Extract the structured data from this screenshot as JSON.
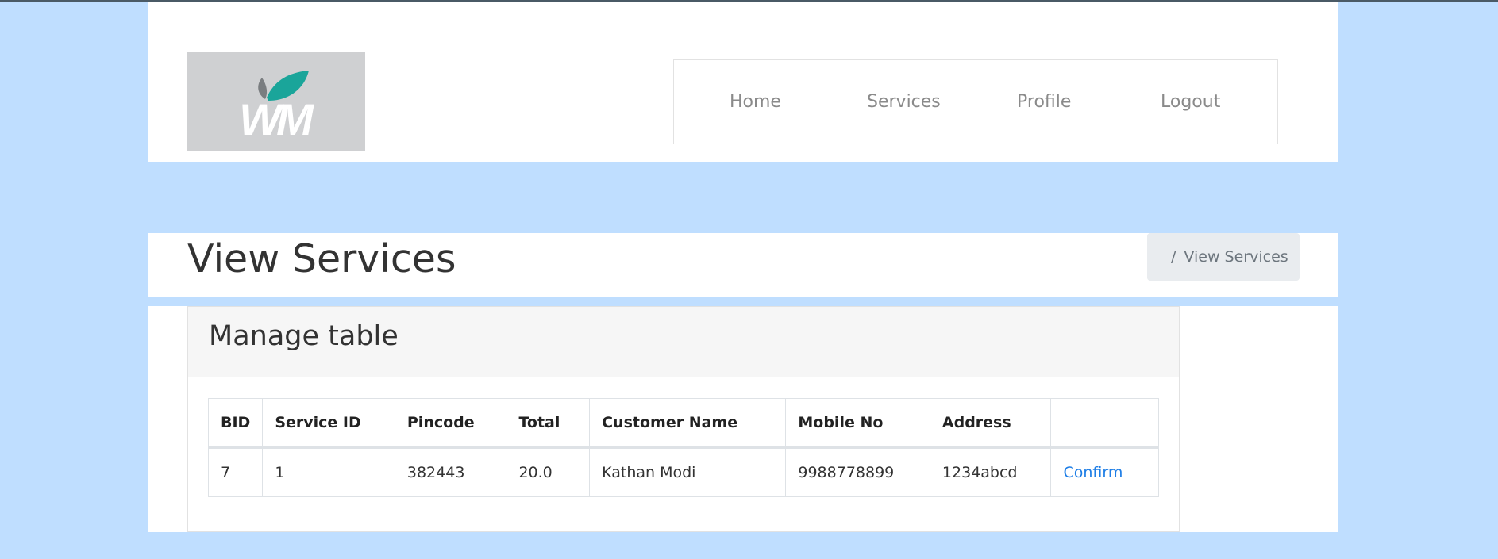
{
  "header": {
    "logo_text": "WM",
    "nav": [
      {
        "label": "Home"
      },
      {
        "label": "Services"
      },
      {
        "label": "Profile"
      },
      {
        "label": "Logout"
      }
    ]
  },
  "page": {
    "title": "View Services",
    "breadcrumb": {
      "separator": "/",
      "current": "View Services"
    }
  },
  "card": {
    "title": "Manage table"
  },
  "table": {
    "columns": [
      "BID",
      "Service ID",
      "Pincode",
      "Total",
      "Customer Name",
      "Mobile No",
      "Address",
      ""
    ],
    "rows": [
      {
        "bid": "7",
        "service_id": "1",
        "pincode": "382443",
        "total": "20.0",
        "customer_name": "Kathan Modi",
        "mobile_no": "9988778899",
        "address": "1234abcd",
        "action": "Confirm"
      }
    ]
  },
  "colors": {
    "page_background": "#bfdeff",
    "logo_background": "#cfd0d2",
    "logo_leaf_teal": "#1aa59a",
    "logo_leaf_gray": "#7a7d80",
    "link_blue": "#1e7ee6",
    "breadcrumb_background": "#e9ecef"
  }
}
